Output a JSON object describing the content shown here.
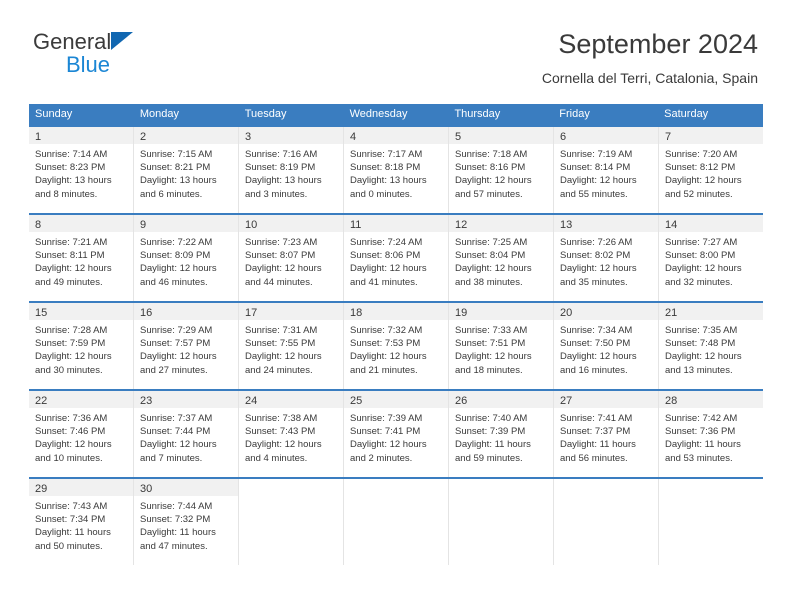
{
  "brand": {
    "name_part1": "General",
    "name_part2": "Blue",
    "triangle_color": "#1167b1",
    "blue_color": "#1b86d4"
  },
  "header": {
    "title": "September 2024",
    "subtitle": "Cornella del Terri, Catalonia, Spain"
  },
  "theme": {
    "header_blue": "#3a7dc0",
    "day_band_gray": "#f1f1f1",
    "cell_border": "#e4e4e4",
    "text": "#3a3a3a"
  },
  "weekdays": [
    "Sunday",
    "Monday",
    "Tuesday",
    "Wednesday",
    "Thursday",
    "Friday",
    "Saturday"
  ],
  "weeks": [
    {
      "days": [
        {
          "num": "1",
          "sunrise": "Sunrise: 7:14 AM",
          "sunset": "Sunset: 8:23 PM",
          "daylight1": "Daylight: 13 hours",
          "daylight2": "and 8 minutes."
        },
        {
          "num": "2",
          "sunrise": "Sunrise: 7:15 AM",
          "sunset": "Sunset: 8:21 PM",
          "daylight1": "Daylight: 13 hours",
          "daylight2": "and 6 minutes."
        },
        {
          "num": "3",
          "sunrise": "Sunrise: 7:16 AM",
          "sunset": "Sunset: 8:19 PM",
          "daylight1": "Daylight: 13 hours",
          "daylight2": "and 3 minutes."
        },
        {
          "num": "4",
          "sunrise": "Sunrise: 7:17 AM",
          "sunset": "Sunset: 8:18 PM",
          "daylight1": "Daylight: 13 hours",
          "daylight2": "and 0 minutes."
        },
        {
          "num": "5",
          "sunrise": "Sunrise: 7:18 AM",
          "sunset": "Sunset: 8:16 PM",
          "daylight1": "Daylight: 12 hours",
          "daylight2": "and 57 minutes."
        },
        {
          "num": "6",
          "sunrise": "Sunrise: 7:19 AM",
          "sunset": "Sunset: 8:14 PM",
          "daylight1": "Daylight: 12 hours",
          "daylight2": "and 55 minutes."
        },
        {
          "num": "7",
          "sunrise": "Sunrise: 7:20 AM",
          "sunset": "Sunset: 8:12 PM",
          "daylight1": "Daylight: 12 hours",
          "daylight2": "and 52 minutes."
        }
      ]
    },
    {
      "days": [
        {
          "num": "8",
          "sunrise": "Sunrise: 7:21 AM",
          "sunset": "Sunset: 8:11 PM",
          "daylight1": "Daylight: 12 hours",
          "daylight2": "and 49 minutes."
        },
        {
          "num": "9",
          "sunrise": "Sunrise: 7:22 AM",
          "sunset": "Sunset: 8:09 PM",
          "daylight1": "Daylight: 12 hours",
          "daylight2": "and 46 minutes."
        },
        {
          "num": "10",
          "sunrise": "Sunrise: 7:23 AM",
          "sunset": "Sunset: 8:07 PM",
          "daylight1": "Daylight: 12 hours",
          "daylight2": "and 44 minutes."
        },
        {
          "num": "11",
          "sunrise": "Sunrise: 7:24 AM",
          "sunset": "Sunset: 8:06 PM",
          "daylight1": "Daylight: 12 hours",
          "daylight2": "and 41 minutes."
        },
        {
          "num": "12",
          "sunrise": "Sunrise: 7:25 AM",
          "sunset": "Sunset: 8:04 PM",
          "daylight1": "Daylight: 12 hours",
          "daylight2": "and 38 minutes."
        },
        {
          "num": "13",
          "sunrise": "Sunrise: 7:26 AM",
          "sunset": "Sunset: 8:02 PM",
          "daylight1": "Daylight: 12 hours",
          "daylight2": "and 35 minutes."
        },
        {
          "num": "14",
          "sunrise": "Sunrise: 7:27 AM",
          "sunset": "Sunset: 8:00 PM",
          "daylight1": "Daylight: 12 hours",
          "daylight2": "and 32 minutes."
        }
      ]
    },
    {
      "days": [
        {
          "num": "15",
          "sunrise": "Sunrise: 7:28 AM",
          "sunset": "Sunset: 7:59 PM",
          "daylight1": "Daylight: 12 hours",
          "daylight2": "and 30 minutes."
        },
        {
          "num": "16",
          "sunrise": "Sunrise: 7:29 AM",
          "sunset": "Sunset: 7:57 PM",
          "daylight1": "Daylight: 12 hours",
          "daylight2": "and 27 minutes."
        },
        {
          "num": "17",
          "sunrise": "Sunrise: 7:31 AM",
          "sunset": "Sunset: 7:55 PM",
          "daylight1": "Daylight: 12 hours",
          "daylight2": "and 24 minutes."
        },
        {
          "num": "18",
          "sunrise": "Sunrise: 7:32 AM",
          "sunset": "Sunset: 7:53 PM",
          "daylight1": "Daylight: 12 hours",
          "daylight2": "and 21 minutes."
        },
        {
          "num": "19",
          "sunrise": "Sunrise: 7:33 AM",
          "sunset": "Sunset: 7:51 PM",
          "daylight1": "Daylight: 12 hours",
          "daylight2": "and 18 minutes."
        },
        {
          "num": "20",
          "sunrise": "Sunrise: 7:34 AM",
          "sunset": "Sunset: 7:50 PM",
          "daylight1": "Daylight: 12 hours",
          "daylight2": "and 16 minutes."
        },
        {
          "num": "21",
          "sunrise": "Sunrise: 7:35 AM",
          "sunset": "Sunset: 7:48 PM",
          "daylight1": "Daylight: 12 hours",
          "daylight2": "and 13 minutes."
        }
      ]
    },
    {
      "days": [
        {
          "num": "22",
          "sunrise": "Sunrise: 7:36 AM",
          "sunset": "Sunset: 7:46 PM",
          "daylight1": "Daylight: 12 hours",
          "daylight2": "and 10 minutes."
        },
        {
          "num": "23",
          "sunrise": "Sunrise: 7:37 AM",
          "sunset": "Sunset: 7:44 PM",
          "daylight1": "Daylight: 12 hours",
          "daylight2": "and 7 minutes."
        },
        {
          "num": "24",
          "sunrise": "Sunrise: 7:38 AM",
          "sunset": "Sunset: 7:43 PM",
          "daylight1": "Daylight: 12 hours",
          "daylight2": "and 4 minutes."
        },
        {
          "num": "25",
          "sunrise": "Sunrise: 7:39 AM",
          "sunset": "Sunset: 7:41 PM",
          "daylight1": "Daylight: 12 hours",
          "daylight2": "and 2 minutes."
        },
        {
          "num": "26",
          "sunrise": "Sunrise: 7:40 AM",
          "sunset": "Sunset: 7:39 PM",
          "daylight1": "Daylight: 11 hours",
          "daylight2": "and 59 minutes."
        },
        {
          "num": "27",
          "sunrise": "Sunrise: 7:41 AM",
          "sunset": "Sunset: 7:37 PM",
          "daylight1": "Daylight: 11 hours",
          "daylight2": "and 56 minutes."
        },
        {
          "num": "28",
          "sunrise": "Sunrise: 7:42 AM",
          "sunset": "Sunset: 7:36 PM",
          "daylight1": "Daylight: 11 hours",
          "daylight2": "and 53 minutes."
        }
      ]
    },
    {
      "days": [
        {
          "num": "29",
          "sunrise": "Sunrise: 7:43 AM",
          "sunset": "Sunset: 7:34 PM",
          "daylight1": "Daylight: 11 hours",
          "daylight2": "and 50 minutes."
        },
        {
          "num": "30",
          "sunrise": "Sunrise: 7:44 AM",
          "sunset": "Sunset: 7:32 PM",
          "daylight1": "Daylight: 11 hours",
          "daylight2": "and 47 minutes."
        },
        {
          "num": "",
          "sunrise": "",
          "sunset": "",
          "daylight1": "",
          "daylight2": ""
        },
        {
          "num": "",
          "sunrise": "",
          "sunset": "",
          "daylight1": "",
          "daylight2": ""
        },
        {
          "num": "",
          "sunrise": "",
          "sunset": "",
          "daylight1": "",
          "daylight2": ""
        },
        {
          "num": "",
          "sunrise": "",
          "sunset": "",
          "daylight1": "",
          "daylight2": ""
        },
        {
          "num": "",
          "sunrise": "",
          "sunset": "",
          "daylight1": "",
          "daylight2": ""
        }
      ]
    }
  ]
}
